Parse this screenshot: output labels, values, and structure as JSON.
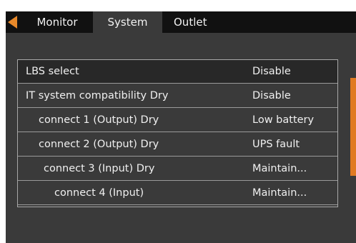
{
  "tabs": {
    "monitor": "Monitor",
    "system": "System",
    "outlet": "Outlet",
    "active": "System"
  },
  "settings": [
    {
      "label": "LBS select",
      "value": "Disable"
    },
    {
      "label": "IT system compatibility Dry",
      "value": "Disable"
    },
    {
      "label": "connect 1 (Output) Dry",
      "value": "Low battery"
    },
    {
      "label": "connect 2 (Output) Dry",
      "value": "UPS fault"
    },
    {
      "label": "connect 3 (Input) Dry",
      "value": "Maintain..."
    },
    {
      "label": "connect 4 (Input)",
      "value": "Maintain..."
    }
  ],
  "colors": {
    "accent": "#e8892a",
    "background": "#3a3a3a",
    "tabbar": "#111111"
  },
  "icons": {
    "back": "back-arrow-icon"
  }
}
